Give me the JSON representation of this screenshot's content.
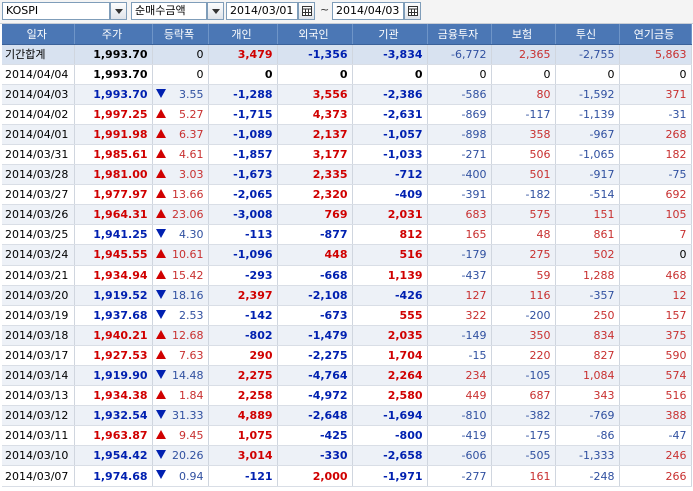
{
  "toolbar": {
    "market": "KOSPI",
    "metric": "순매수금액",
    "date_from": "2014/03/01",
    "separator": "~",
    "date_to": "2014/04/03"
  },
  "columns": [
    "일자",
    "주가",
    "등락폭",
    "개인",
    "외국인",
    "기관",
    "금융투자",
    "보험",
    "투신",
    "연기금등"
  ],
  "summary": {
    "date": "기간합계",
    "price": "1,993.70",
    "change": "0",
    "individual": "3,479",
    "foreign": "-1,356",
    "institution": "-3,834",
    "fin_invest": "-6,772",
    "insurance": "2,365",
    "trust": "-2,755",
    "pension": "5,863"
  },
  "rows": [
    {
      "date": "2014/04/04",
      "price": "1,993.70",
      "dir": "none",
      "change": "0",
      "individual": "0",
      "foreign": "0",
      "institution": "0",
      "fin_invest": "0",
      "insurance": "0",
      "trust": "0",
      "pension": "0"
    },
    {
      "date": "2014/04/03",
      "price": "1,993.70",
      "dir": "down",
      "change": "3.55",
      "individual": "-1,288",
      "foreign": "3,556",
      "institution": "-2,386",
      "fin_invest": "-586",
      "insurance": "80",
      "trust": "-1,592",
      "pension": "371"
    },
    {
      "date": "2014/04/02",
      "price": "1,997.25",
      "dir": "up",
      "change": "5.27",
      "individual": "-1,715",
      "foreign": "4,373",
      "institution": "-2,631",
      "fin_invest": "-869",
      "insurance": "-117",
      "trust": "-1,139",
      "pension": "-31"
    },
    {
      "date": "2014/04/01",
      "price": "1,991.98",
      "dir": "up",
      "change": "6.37",
      "individual": "-1,089",
      "foreign": "2,137",
      "institution": "-1,057",
      "fin_invest": "-898",
      "insurance": "358",
      "trust": "-967",
      "pension": "268"
    },
    {
      "date": "2014/03/31",
      "price": "1,985.61",
      "dir": "up",
      "change": "4.61",
      "individual": "-1,857",
      "foreign": "3,177",
      "institution": "-1,033",
      "fin_invest": "-271",
      "insurance": "506",
      "trust": "-1,065",
      "pension": "182"
    },
    {
      "date": "2014/03/28",
      "price": "1,981.00",
      "dir": "up",
      "change": "3.03",
      "individual": "-1,673",
      "foreign": "2,335",
      "institution": "-712",
      "fin_invest": "-400",
      "insurance": "501",
      "trust": "-917",
      "pension": "-75"
    },
    {
      "date": "2014/03/27",
      "price": "1,977.97",
      "dir": "up",
      "change": "13.66",
      "individual": "-2,065",
      "foreign": "2,320",
      "institution": "-409",
      "fin_invest": "-391",
      "insurance": "-182",
      "trust": "-514",
      "pension": "692"
    },
    {
      "date": "2014/03/26",
      "price": "1,964.31",
      "dir": "up",
      "change": "23.06",
      "individual": "-3,008",
      "foreign": "769",
      "institution": "2,031",
      "fin_invest": "683",
      "insurance": "575",
      "trust": "151",
      "pension": "105"
    },
    {
      "date": "2014/03/25",
      "price": "1,941.25",
      "dir": "down",
      "change": "4.30",
      "individual": "-113",
      "foreign": "-877",
      "institution": "812",
      "fin_invest": "165",
      "insurance": "48",
      "trust": "861",
      "pension": "7"
    },
    {
      "date": "2014/03/24",
      "price": "1,945.55",
      "dir": "up",
      "change": "10.61",
      "individual": "-1,096",
      "foreign": "448",
      "institution": "516",
      "fin_invest": "-179",
      "insurance": "275",
      "trust": "502",
      "pension": "0"
    },
    {
      "date": "2014/03/21",
      "price": "1,934.94",
      "dir": "up",
      "change": "15.42",
      "individual": "-293",
      "foreign": "-668",
      "institution": "1,139",
      "fin_invest": "-437",
      "insurance": "59",
      "trust": "1,288",
      "pension": "468"
    },
    {
      "date": "2014/03/20",
      "price": "1,919.52",
      "dir": "down",
      "change": "18.16",
      "individual": "2,397",
      "foreign": "-2,108",
      "institution": "-426",
      "fin_invest": "127",
      "insurance": "116",
      "trust": "-357",
      "pension": "12"
    },
    {
      "date": "2014/03/19",
      "price": "1,937.68",
      "dir": "down",
      "change": "2.53",
      "individual": "-142",
      "foreign": "-673",
      "institution": "555",
      "fin_invest": "322",
      "insurance": "-200",
      "trust": "250",
      "pension": "157"
    },
    {
      "date": "2014/03/18",
      "price": "1,940.21",
      "dir": "up",
      "change": "12.68",
      "individual": "-802",
      "foreign": "-1,479",
      "institution": "2,035",
      "fin_invest": "-149",
      "insurance": "350",
      "trust": "834",
      "pension": "375"
    },
    {
      "date": "2014/03/17",
      "price": "1,927.53",
      "dir": "up",
      "change": "7.63",
      "individual": "290",
      "foreign": "-2,275",
      "institution": "1,704",
      "fin_invest": "-15",
      "insurance": "220",
      "trust": "827",
      "pension": "590"
    },
    {
      "date": "2014/03/14",
      "price": "1,919.90",
      "dir": "down",
      "change": "14.48",
      "individual": "2,275",
      "foreign": "-4,764",
      "institution": "2,264",
      "fin_invest": "234",
      "insurance": "-105",
      "trust": "1,084",
      "pension": "574"
    },
    {
      "date": "2014/03/13",
      "price": "1,934.38",
      "dir": "up",
      "change": "1.84",
      "individual": "2,258",
      "foreign": "-4,972",
      "institution": "2,580",
      "fin_invest": "449",
      "insurance": "687",
      "trust": "343",
      "pension": "516"
    },
    {
      "date": "2014/03/12",
      "price": "1,932.54",
      "dir": "down",
      "change": "31.33",
      "individual": "4,889",
      "foreign": "-2,648",
      "institution": "-1,694",
      "fin_invest": "-810",
      "insurance": "-382",
      "trust": "-769",
      "pension": "388"
    },
    {
      "date": "2014/03/11",
      "price": "1,963.87",
      "dir": "up",
      "change": "9.45",
      "individual": "1,075",
      "foreign": "-425",
      "institution": "-800",
      "fin_invest": "-419",
      "insurance": "-175",
      "trust": "-86",
      "pension": "-47"
    },
    {
      "date": "2014/03/10",
      "price": "1,954.42",
      "dir": "down",
      "change": "20.26",
      "individual": "3,014",
      "foreign": "-330",
      "institution": "-2,658",
      "fin_invest": "-606",
      "insurance": "-505",
      "trust": "-1,333",
      "pension": "246"
    },
    {
      "date": "2014/03/07",
      "price": "1,974.68",
      "dir": "down",
      "change": "0.94",
      "individual": "-121",
      "foreign": "2,000",
      "institution": "-1,971",
      "fin_invest": "-277",
      "insurance": "161",
      "trust": "-248",
      "pension": "266"
    }
  ],
  "colors": {
    "header": "#4b77b5",
    "up": "#d00000",
    "down": "#0020b0",
    "stripe": "#edf1f7",
    "summary": "#d8e2f0"
  }
}
